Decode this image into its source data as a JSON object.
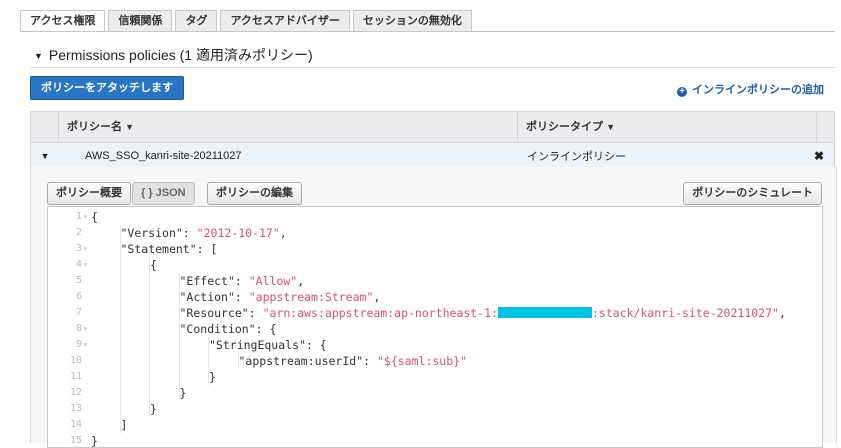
{
  "tabs": [
    "アクセス権限",
    "信頼関係",
    "タグ",
    "アクセスアドバイザー",
    "セッションの無効化"
  ],
  "permissions": {
    "title": "Permissions policies (1 適用済みポリシー)",
    "attach_button": "ポリシーをアタッチします",
    "add_inline": "インラインポリシーの追加"
  },
  "table": {
    "col_name": "ポリシー名",
    "col_type": "ポリシータイプ",
    "row": {
      "name": "AWS_SSO_kanri-site-20211027",
      "type": "インラインポリシー"
    }
  },
  "detail": {
    "btn_summary": "ポリシー概要",
    "btn_json": "{ } JSON",
    "btn_edit": "ポリシーの編集",
    "btn_simulate": "ポリシーのシミュレート"
  },
  "editor": {
    "lines": [
      {
        "n": "1",
        "fold": true,
        "indent": 0,
        "parts": [
          {
            "t": "{",
            "c": "k"
          }
        ]
      },
      {
        "n": "2",
        "fold": false,
        "indent": 1,
        "parts": [
          {
            "t": "\"Version\": ",
            "c": "k"
          },
          {
            "t": "\"2012-10-17\"",
            "c": "s"
          },
          {
            "t": ",",
            "c": "k"
          }
        ]
      },
      {
        "n": "3",
        "fold": true,
        "indent": 1,
        "parts": [
          {
            "t": "\"Statement\": [",
            "c": "k"
          }
        ]
      },
      {
        "n": "4",
        "fold": true,
        "indent": 2,
        "parts": [
          {
            "t": "{",
            "c": "k"
          }
        ]
      },
      {
        "n": "5",
        "fold": false,
        "indent": 3,
        "parts": [
          {
            "t": "\"Effect\": ",
            "c": "k"
          },
          {
            "t": "\"Allow\"",
            "c": "s"
          },
          {
            "t": ",",
            "c": "k"
          }
        ]
      },
      {
        "n": "6",
        "fold": false,
        "indent": 3,
        "parts": [
          {
            "t": "\"Action\": ",
            "c": "k"
          },
          {
            "t": "\"appstream:Stream\"",
            "c": "s"
          },
          {
            "t": ",",
            "c": "k"
          }
        ]
      },
      {
        "n": "7",
        "fold": false,
        "indent": 3,
        "parts": [
          {
            "t": "\"Resource\": ",
            "c": "k"
          },
          {
            "t": "\"arn:aws:appstream:ap-northeast-1:",
            "c": "s"
          },
          {
            "t": "",
            "c": "redact"
          },
          {
            "t": ":stack/kanri-site-20211027\"",
            "c": "s"
          },
          {
            "t": ",",
            "c": "k"
          }
        ]
      },
      {
        "n": "8",
        "fold": true,
        "indent": 3,
        "parts": [
          {
            "t": "\"Condition\": {",
            "c": "k"
          }
        ]
      },
      {
        "n": "9",
        "fold": true,
        "indent": 4,
        "parts": [
          {
            "t": "\"StringEquals\": {",
            "c": "k"
          }
        ]
      },
      {
        "n": "10",
        "fold": false,
        "indent": 5,
        "parts": [
          {
            "t": "\"appstream:userId\": ",
            "c": "k"
          },
          {
            "t": "\"${saml:sub}\"",
            "c": "s"
          }
        ]
      },
      {
        "n": "11",
        "fold": false,
        "indent": 4,
        "parts": [
          {
            "t": "}",
            "c": "k"
          }
        ]
      },
      {
        "n": "12",
        "fold": false,
        "indent": 3,
        "parts": [
          {
            "t": "}",
            "c": "k"
          }
        ]
      },
      {
        "n": "13",
        "fold": false,
        "indent": 2,
        "parts": [
          {
            "t": "}",
            "c": "k"
          }
        ]
      },
      {
        "n": "14",
        "fold": false,
        "indent": 1,
        "parts": [
          {
            "t": "]",
            "c": "k"
          }
        ]
      },
      {
        "n": "15",
        "fold": false,
        "indent": 0,
        "parts": [
          {
            "t": "}",
            "c": "k"
          }
        ]
      }
    ]
  }
}
